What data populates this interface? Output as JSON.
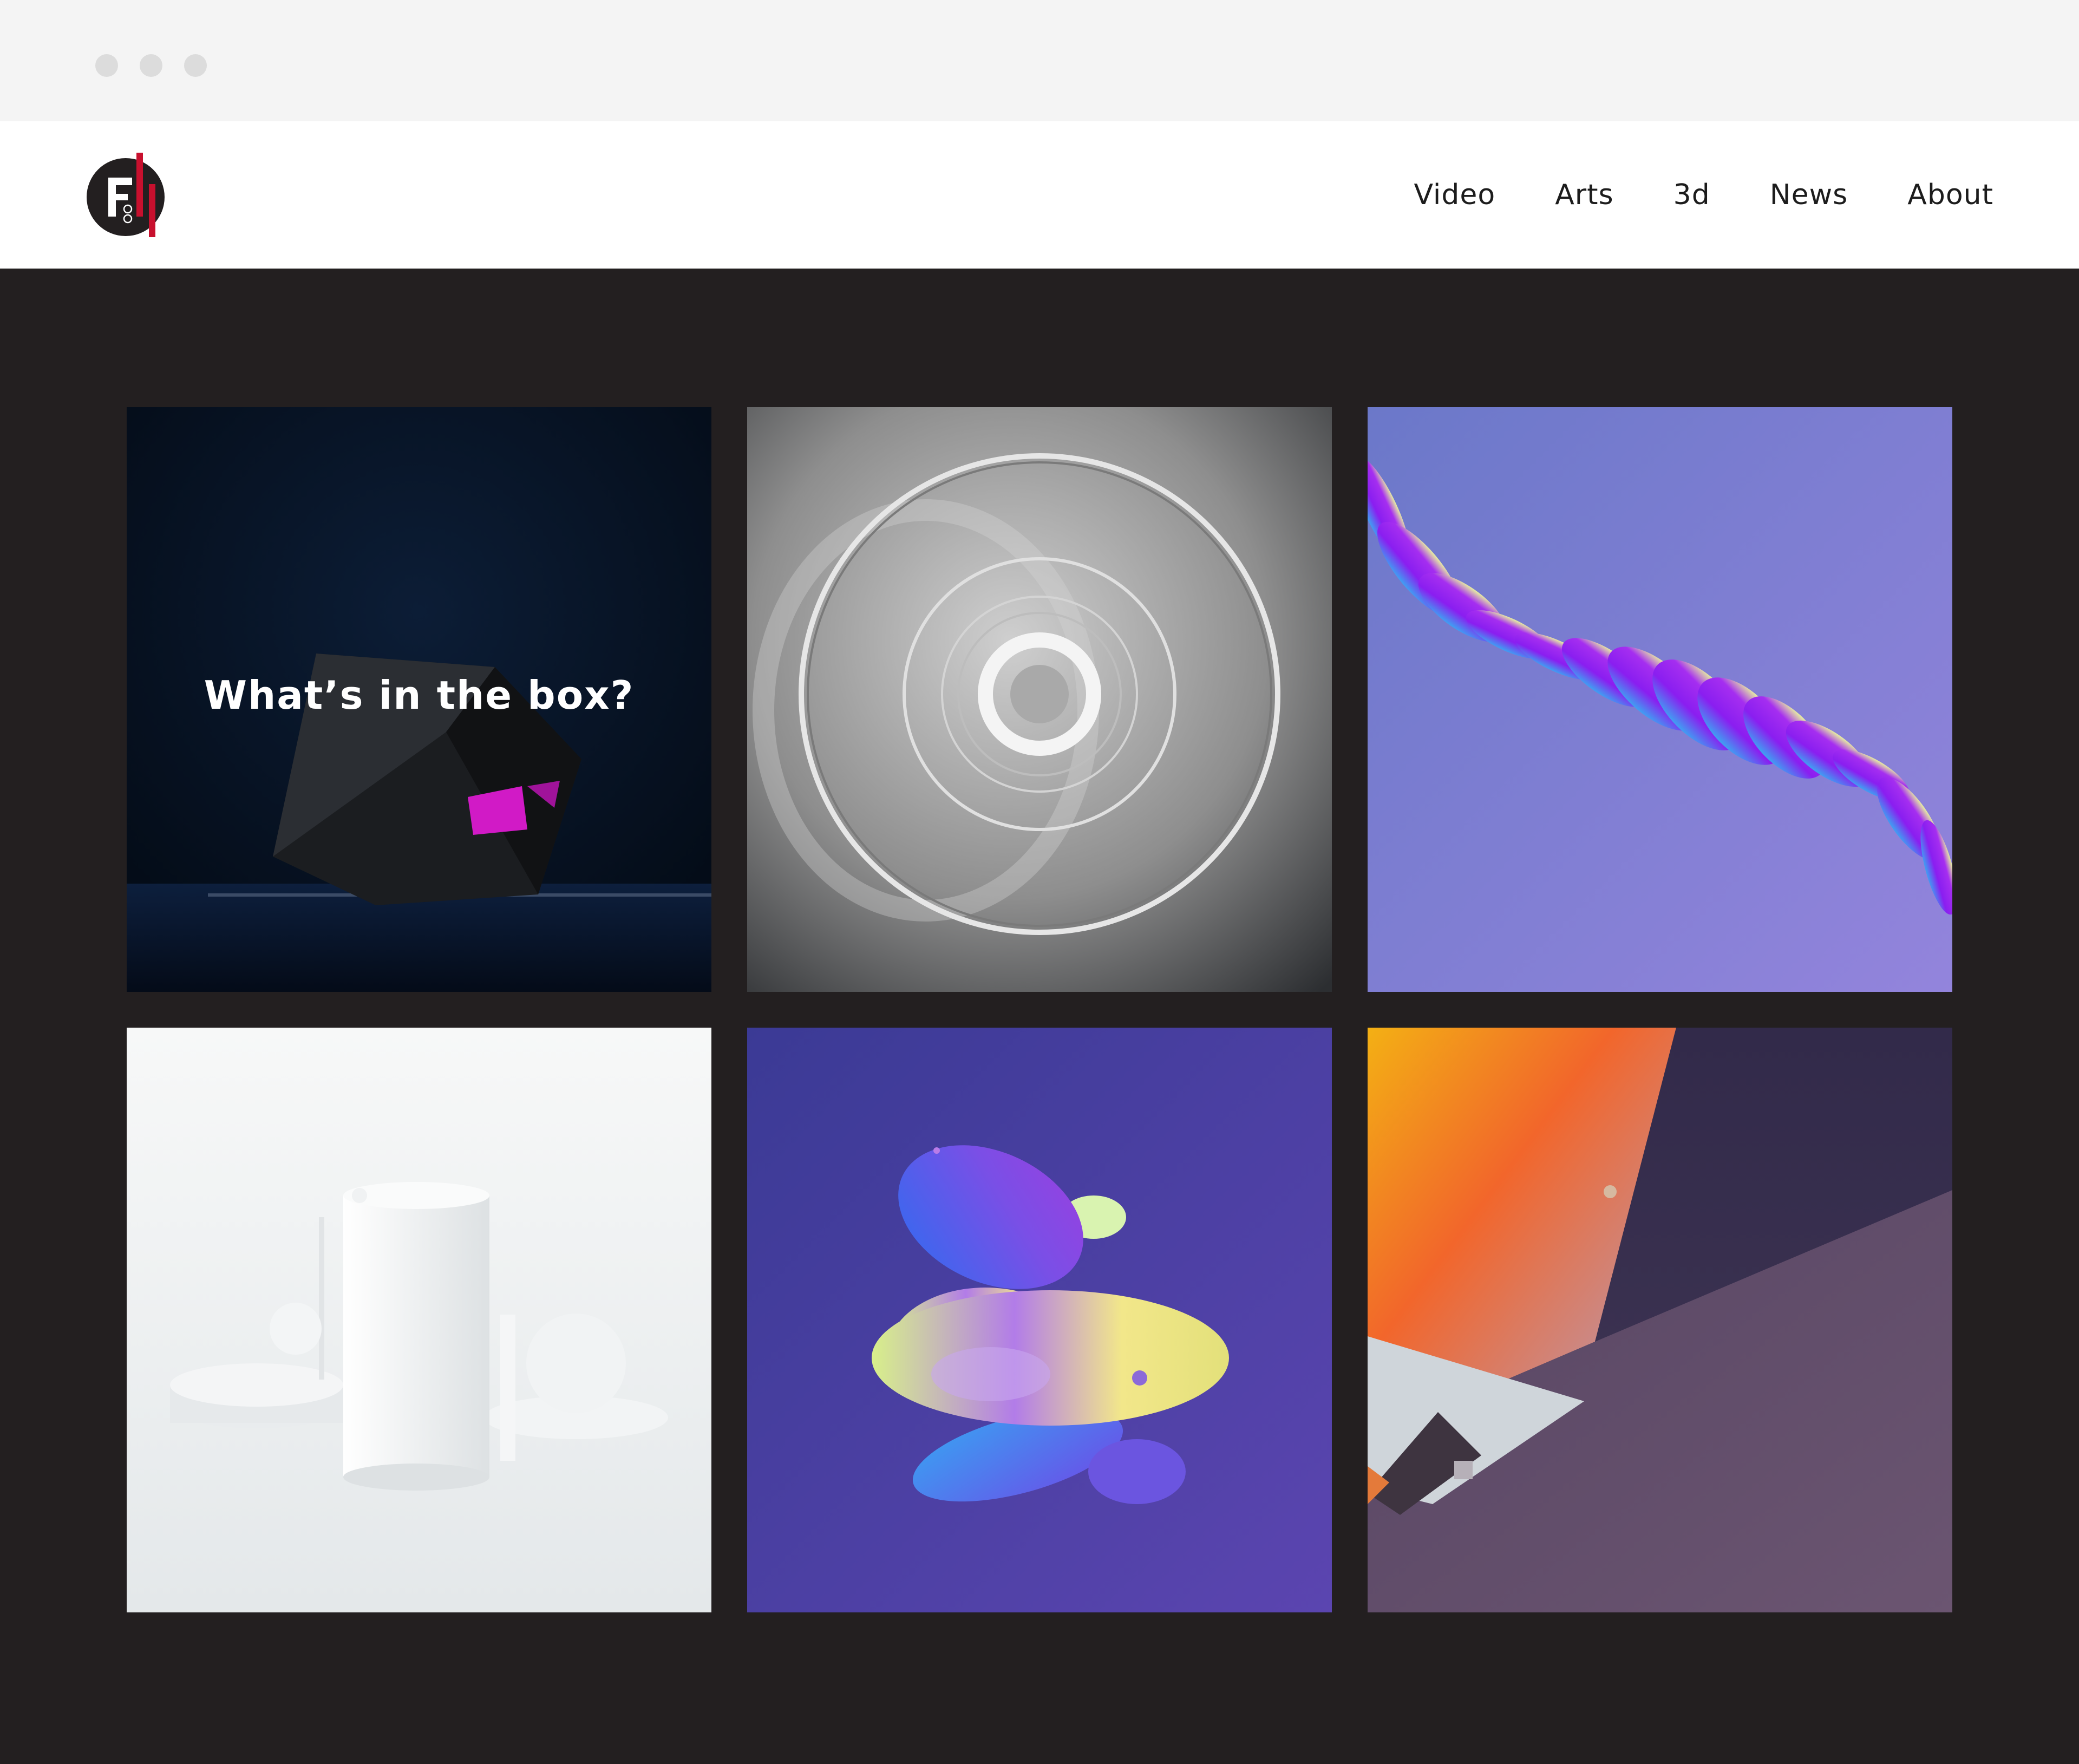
{
  "window": {
    "traffic_lights": [
      "close",
      "minimize",
      "maximize"
    ]
  },
  "header": {
    "logo": {
      "letters": "F"
    },
    "nav": [
      {
        "label": "Video"
      },
      {
        "label": "Arts"
      },
      {
        "label": "3d"
      },
      {
        "label": "News"
      },
      {
        "label": "About"
      }
    ]
  },
  "gallery": {
    "tiles": [
      {
        "caption": "What’s in the box?"
      },
      {
        "caption": ""
      },
      {
        "caption": ""
      },
      {
        "caption": ""
      },
      {
        "caption": ""
      },
      {
        "caption": ""
      }
    ]
  },
  "colors": {
    "page_background": "#231f20",
    "chrome_bar": "#f4f4f4",
    "header_background": "#ffffff",
    "logo_red": "#c8102e",
    "nav_text": "#1c1c1c"
  }
}
